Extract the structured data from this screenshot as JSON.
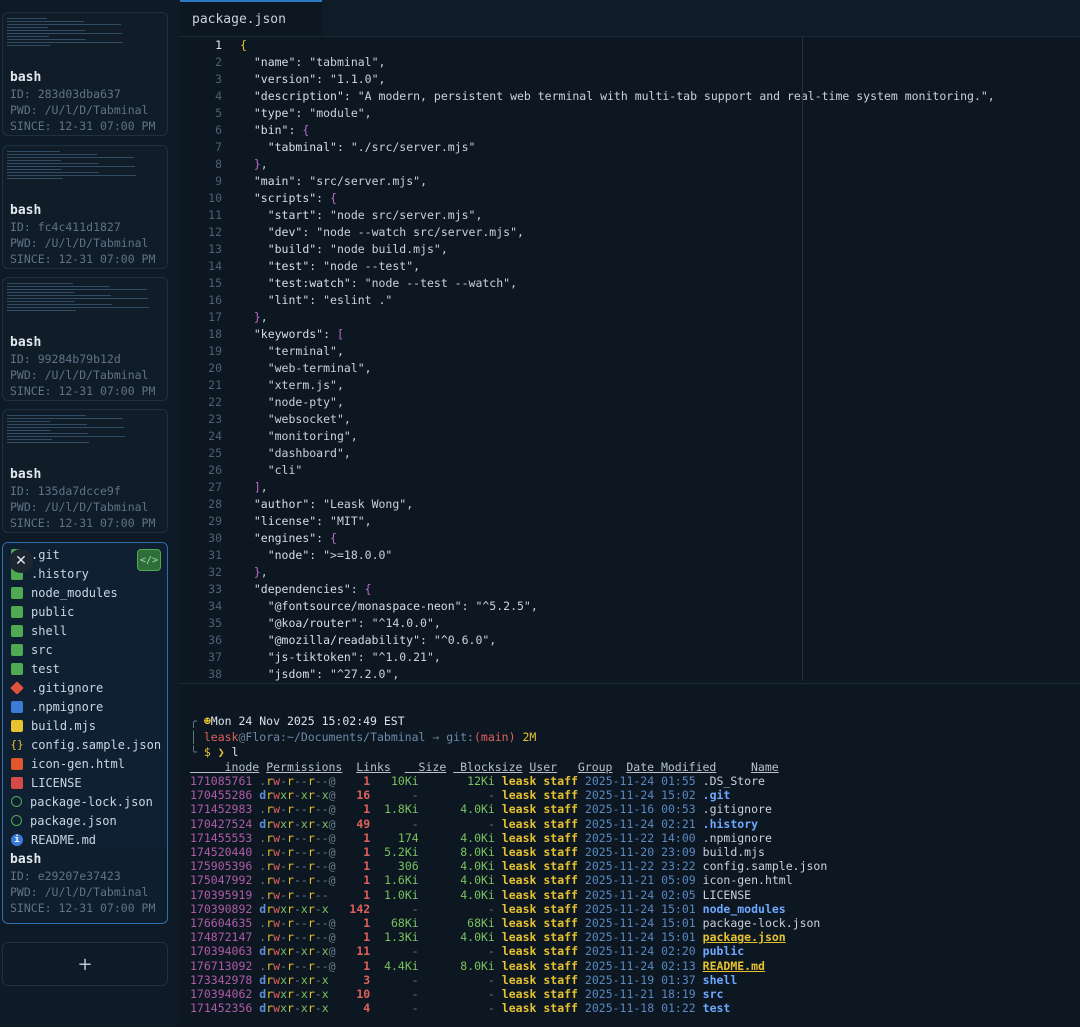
{
  "sessions": [
    {
      "title": "bash",
      "id": "ID: 283d03dba637",
      "pwd": "PWD: /U/l/D/Tabminal",
      "since": "SINCE: 12-31 07:00 PM"
    },
    {
      "title": "bash",
      "id": "ID: fc4c411d1827",
      "pwd": "PWD: /U/l/D/Tabminal",
      "since": "SINCE: 12-31 07:00 PM"
    },
    {
      "title": "bash",
      "id": "ID: 99284b79b12d",
      "pwd": "PWD: /U/l/D/Tabminal",
      "since": "SINCE: 12-31 07:00 PM"
    },
    {
      "title": "bash",
      "id": "ID: 135da7dcce9f",
      "pwd": "PWD: /U/l/D/Tabminal",
      "since": "SINCE: 12-31 07:00 PM"
    }
  ],
  "active_session": {
    "title": "bash",
    "id": "ID: e29207e37423",
    "pwd": "PWD: /U/l/D/Tabminal",
    "since": "SINCE: 12-31 07:00 PM",
    "close_glyph": "✕",
    "files": [
      {
        "name": ".git",
        "icon": "folder"
      },
      {
        "name": ".history",
        "icon": "folder"
      },
      {
        "name": "node_modules",
        "icon": "folder"
      },
      {
        "name": "public",
        "icon": "folder"
      },
      {
        "name": "shell",
        "icon": "folder"
      },
      {
        "name": "src",
        "icon": "folder"
      },
      {
        "name": "test",
        "icon": "folder"
      },
      {
        "name": ".gitignore",
        "icon": "git"
      },
      {
        "name": ".npmignore",
        "icon": "doc"
      },
      {
        "name": "build.mjs",
        "icon": "js"
      },
      {
        "name": "config.sample.json",
        "icon": "json"
      },
      {
        "name": "icon-gen.html",
        "icon": "html"
      },
      {
        "name": "LICENSE",
        "icon": "license"
      },
      {
        "name": "package-lock.json",
        "icon": "pkg"
      },
      {
        "name": "package.json",
        "icon": "pkg"
      },
      {
        "name": "README.md",
        "icon": "info"
      }
    ]
  },
  "add_button": "+",
  "editor": {
    "tab": "package.json",
    "current_line": 1,
    "lines": [
      "{",
      "  \"name\": \"tabminal\",",
      "  \"version\": \"1.1.0\",",
      "  \"description\": \"A modern, persistent web terminal with multi-tab support and real-time system monitoring.\",",
      "  \"type\": \"module\",",
      "  \"bin\": {",
      "    \"tabminal\": \"./src/server.mjs\"",
      "  },",
      "  \"main\": \"src/server.mjs\",",
      "  \"scripts\": {",
      "    \"start\": \"node src/server.mjs\",",
      "    \"dev\": \"node --watch src/server.mjs\",",
      "    \"build\": \"node build.mjs\",",
      "    \"test\": \"node --test\",",
      "    \"test:watch\": \"node --test --watch\",",
      "    \"lint\": \"eslint .\"",
      "  },",
      "  \"keywords\": [",
      "    \"terminal\",",
      "    \"web-terminal\",",
      "    \"xterm.js\",",
      "    \"node-pty\",",
      "    \"websocket\",",
      "    \"monitoring\",",
      "    \"dashboard\",",
      "    \"cli\"",
      "  ],",
      "  \"author\": \"Leask Wong\",",
      "  \"license\": \"MIT\",",
      "  \"engines\": {",
      "    \"node\": \">=18.0.0\"",
      "  },",
      "  \"dependencies\": {",
      "    \"@fontsource/monaspace-neon\": \"^5.2.5\",",
      "    \"@koa/router\": \"^14.0.0\",",
      "    \"@mozilla/readability\": \"^0.6.0\",",
      "    \"js-tiktoken\": \"^1.0.21\",",
      "    \"jsdom\": \"^27.2.0\","
    ]
  },
  "terminal": {
    "prompt_date": "Mon 24 Nov 2025 15:02:49 EST",
    "prompt_user": "leask",
    "prompt_host": "Flora",
    "prompt_path": "~/Documents/Tabminal",
    "prompt_git_label": "git:",
    "prompt_branch": "main",
    "prompt_status": "2M",
    "command": "l",
    "headers": [
      "inode",
      "Permissions",
      "Links",
      "Size",
      "Blocksize",
      "User",
      "Group",
      "Date Modified",
      "Name"
    ],
    "rows": [
      [
        "171085761",
        ".rw-r--r--@",
        "1",
        "10Ki",
        "12Ki",
        "leask",
        "staff",
        "2025-11-24 01:55",
        ".DS_Store",
        "file"
      ],
      [
        "170455286",
        "drwxr-xr-x@",
        "16",
        "-",
        "-",
        "leask",
        "staff",
        "2025-11-24 15:02",
        ".git",
        "dir"
      ],
      [
        "171452983",
        ".rw-r--r--@",
        "1",
        "1.8Ki",
        "4.0Ki",
        "leask",
        "staff",
        "2025-11-16 00:53",
        ".gitignore",
        "file"
      ],
      [
        "170427524",
        "drwxr-xr-x@",
        "49",
        "-",
        "-",
        "leask",
        "staff",
        "2025-11-24 02:21",
        ".history",
        "dir"
      ],
      [
        "171455553",
        ".rw-r--r--@",
        "1",
        "174",
        "4.0Ki",
        "leask",
        "staff",
        "2025-11-22 14:00",
        ".npmignore",
        "file"
      ],
      [
        "174520440",
        ".rw-r--r--@",
        "1",
        "5.2Ki",
        "8.0Ki",
        "leask",
        "staff",
        "2025-11-20 23:09",
        "build.mjs",
        "file"
      ],
      [
        "175905396",
        ".rw-r--r--@",
        "1",
        "306",
        "4.0Ki",
        "leask",
        "staff",
        "2025-11-22 23:22",
        "config.sample.json",
        "file"
      ],
      [
        "175047992",
        ".rw-r--r--@",
        "1",
        "1.6Ki",
        "4.0Ki",
        "leask",
        "staff",
        "2025-11-21 05:09",
        "icon-gen.html",
        "file"
      ],
      [
        "170395919",
        ".rw-r--r--",
        "1",
        "1.0Ki",
        "4.0Ki",
        "leask",
        "staff",
        "2025-11-24 02:05",
        "LICENSE",
        "file"
      ],
      [
        "170390892",
        "drwxr-xr-x",
        "142",
        "-",
        "-",
        "leask",
        "staff",
        "2025-11-24 15:01",
        "node_modules",
        "dir"
      ],
      [
        "176604635",
        ".rw-r--r--@",
        "1",
        "68Ki",
        "68Ki",
        "leask",
        "staff",
        "2025-11-24 15:01",
        "package-lock.json",
        "file"
      ],
      [
        "174872147",
        ".rw-r--r--@",
        "1",
        "1.3Ki",
        "4.0Ki",
        "leask",
        "staff",
        "2025-11-24 15:01",
        "package.json",
        "hl"
      ],
      [
        "170394063",
        "drwxr-xr-x@",
        "11",
        "-",
        "-",
        "leask",
        "staff",
        "2025-11-24 02:20",
        "public",
        "dir"
      ],
      [
        "176713092",
        ".rw-r--r--@",
        "1",
        "4.4Ki",
        "8.0Ki",
        "leask",
        "staff",
        "2025-11-24 02:13",
        "README.md",
        "hl"
      ],
      [
        "173342978",
        "drwxr-xr-x",
        "3",
        "-",
        "-",
        "leask",
        "staff",
        "2025-11-19 01:37",
        "shell",
        "dir"
      ],
      [
        "170394062",
        "drwxr-xr-x",
        "10",
        "-",
        "-",
        "leask",
        "staff",
        "2025-11-21 18:19",
        "src",
        "dir"
      ],
      [
        "171452356",
        "drwxr-xr-x",
        "4",
        "-",
        "-",
        "leask",
        "staff",
        "2025-11-18 01:22",
        "test",
        "dir"
      ]
    ]
  }
}
